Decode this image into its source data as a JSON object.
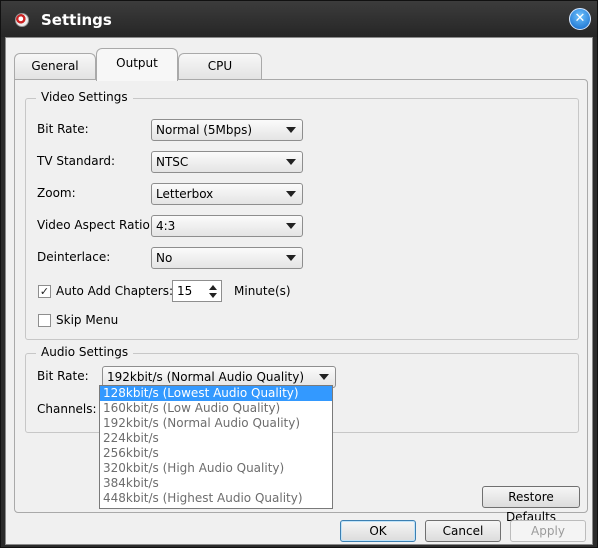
{
  "window": {
    "title": "Settings"
  },
  "tabs": [
    {
      "label": "General"
    },
    {
      "label": "Output"
    },
    {
      "label": "CPU"
    }
  ],
  "video_settings": {
    "title": "Video Settings",
    "bit_rate": {
      "label": "Bit Rate:",
      "value": "Normal (5Mbps)"
    },
    "tv_standard": {
      "label": "TV Standard:",
      "value": "NTSC"
    },
    "zoom": {
      "label": "Zoom:",
      "value": "Letterbox"
    },
    "aspect_ratio": {
      "label": "Video Aspect Ratio:",
      "value": "4:3"
    },
    "deinterlace": {
      "label": "Deinterlace:",
      "value": "No"
    },
    "auto_add_chapters": {
      "label": "Auto Add Chapters:",
      "checked": true,
      "value": "15",
      "unit": "Minute(s)"
    },
    "skip_menu": {
      "label": "Skip Menu",
      "checked": false
    }
  },
  "audio_settings": {
    "title": "Audio Settings",
    "bit_rate": {
      "label": "Bit Rate:",
      "value": "192kbit/s (Normal Audio Quality)",
      "options": [
        "128kbit/s (Lowest Audio Quality)",
        "160kbit/s (Low Audio Quality)",
        "192kbit/s (Normal Audio Quality)",
        "224kbit/s",
        "256kbit/s",
        "320kbit/s (High Audio Quality)",
        "384kbit/s",
        "448kbit/s (Highest Audio Quality)"
      ],
      "highlighted_index": 0
    },
    "channels": {
      "label": "Channels:"
    }
  },
  "buttons": {
    "restore_defaults": "Restore Defaults",
    "ok": "OK",
    "cancel": "Cancel",
    "apply": "Apply"
  },
  "colors": {
    "selection": "#3399ff",
    "titlebar": "#2b2b2b"
  }
}
